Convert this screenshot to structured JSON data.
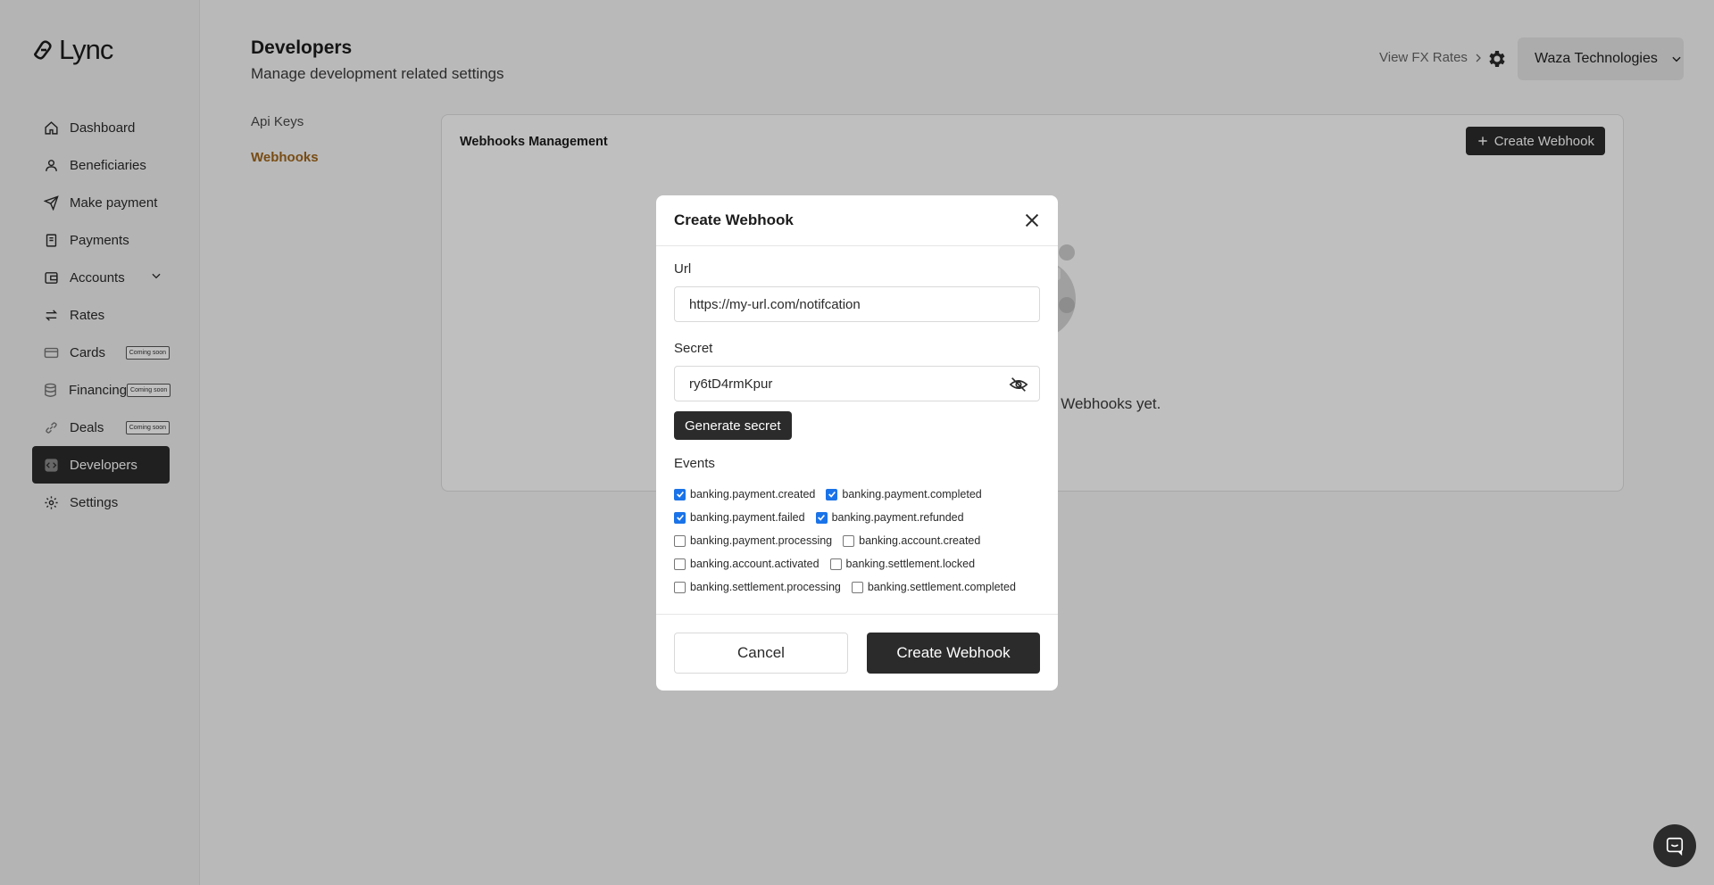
{
  "app": {
    "logo_text": "Lync"
  },
  "sidebar": {
    "items": [
      {
        "label": "Dashboard",
        "icon": "home-icon"
      },
      {
        "label": "Beneficiaries",
        "icon": "user-icon"
      },
      {
        "label": "Make payment",
        "icon": "send-icon"
      },
      {
        "label": "Payments",
        "icon": "document-icon"
      },
      {
        "label": "Accounts",
        "icon": "wallet-icon"
      },
      {
        "label": "Rates",
        "icon": "swap-icon"
      },
      {
        "label": "Cards",
        "icon": "card-icon",
        "badge": "Coming soon"
      },
      {
        "label": "Financing",
        "icon": "database-icon",
        "badge": "Coming soon"
      },
      {
        "label": "Deals",
        "icon": "link-icon",
        "badge": "Coming soon"
      },
      {
        "label": "Developers",
        "icon": "code-icon"
      },
      {
        "label": "Settings",
        "icon": "gear-icon"
      }
    ]
  },
  "header": {
    "title": "Developers",
    "subtitle": "Manage development related settings",
    "fx_link": "View FX Rates",
    "company": "Waza Technologies"
  },
  "subnav": {
    "items": [
      "Api Keys",
      "Webhooks"
    ]
  },
  "card": {
    "title": "Webhooks Management",
    "create_label": "Create Webhook",
    "empty_text": "y Webhooks yet."
  },
  "modal": {
    "title": "Create Webhook",
    "url_label": "Url",
    "url_value": "https://my-url.com/notifcation",
    "secret_label": "Secret",
    "secret_value": "ry6tD4rmKpur",
    "generate_label": "Generate secret",
    "events_label": "Events",
    "events": [
      {
        "name": "banking.payment.created",
        "checked": true
      },
      {
        "name": "banking.payment.completed",
        "checked": true
      },
      {
        "name": "banking.payment.failed",
        "checked": true
      },
      {
        "name": "banking.payment.refunded",
        "checked": true
      },
      {
        "name": "banking.payment.processing",
        "checked": false
      },
      {
        "name": "banking.account.created",
        "checked": false
      },
      {
        "name": "banking.account.activated",
        "checked": false
      },
      {
        "name": "banking.settlement.locked",
        "checked": false
      },
      {
        "name": "banking.settlement.processing",
        "checked": false
      },
      {
        "name": "banking.settlement.completed",
        "checked": false
      }
    ],
    "cancel_label": "Cancel",
    "submit_label": "Create Webhook"
  },
  "colors": {
    "accent": "#a0661b",
    "primary_dark": "#2b2b2b",
    "checkbox": "#1a73e8"
  }
}
